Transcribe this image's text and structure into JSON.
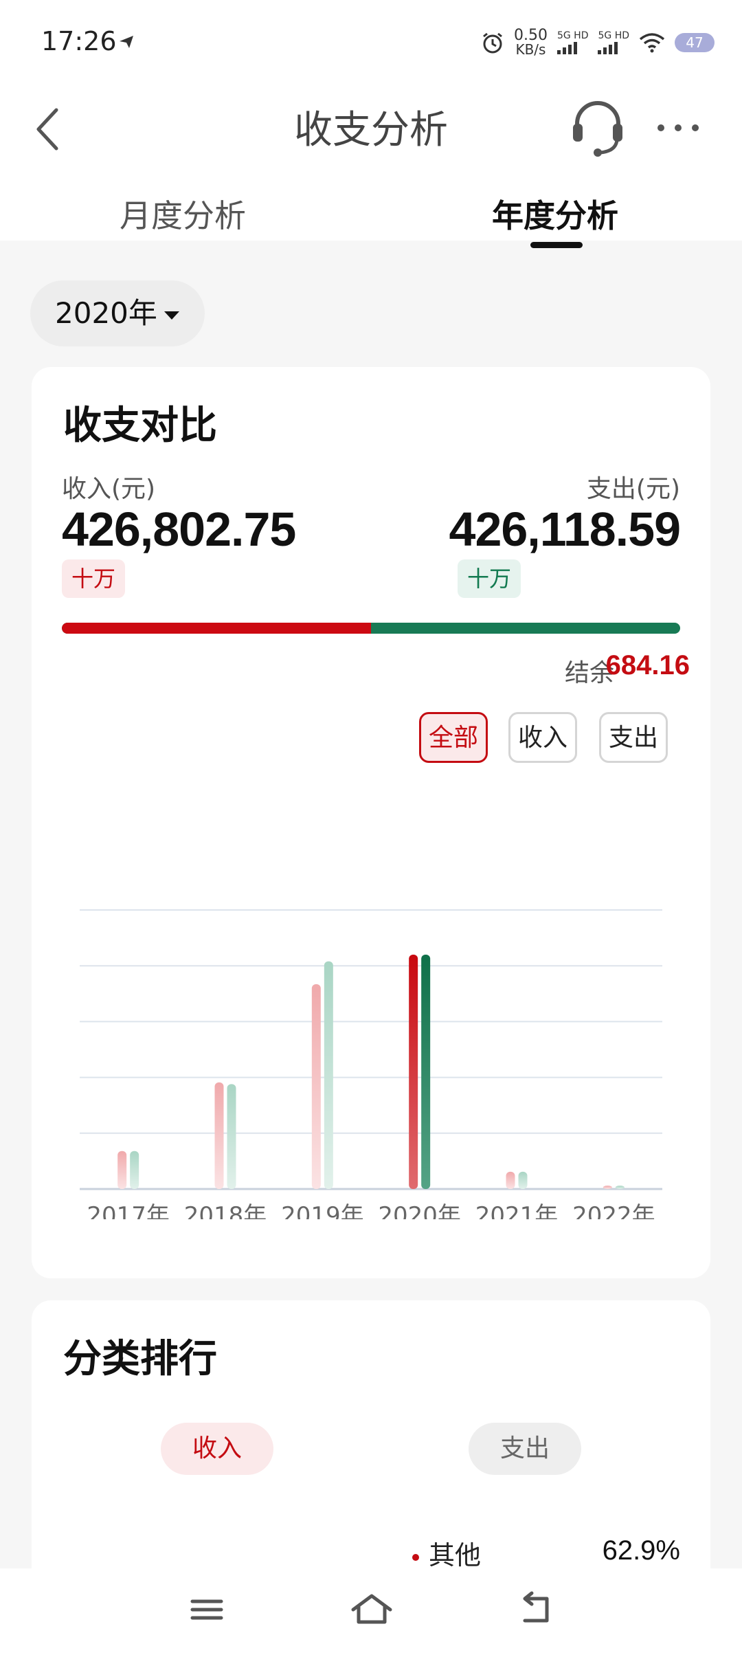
{
  "status": {
    "time": "17:26",
    "speed_value": "0.50",
    "speed_unit": "KB/s",
    "sig1_label": "5G HD",
    "sig2_label": "5G HD",
    "battery": "47"
  },
  "header": {
    "title": "收支分析",
    "tabs": [
      {
        "label": "月度分析",
        "active": false
      },
      {
        "label": "年度分析",
        "active": true
      }
    ]
  },
  "year_selector": {
    "value": "2020年"
  },
  "comparison": {
    "title": "收支对比",
    "income_label": "收入(元)",
    "income_amount": "426,802.75",
    "income_unit": "十万",
    "expense_label": "支出(元)",
    "expense_amount": "426,118.59",
    "expense_unit": "十万",
    "income_ratio": 0.5004,
    "balance_label": "结余",
    "balance_value": "684.16",
    "filters": [
      {
        "label": "全部",
        "active": true
      },
      {
        "label": "收入",
        "active": false
      },
      {
        "label": "支出",
        "active": false
      }
    ]
  },
  "chart_data": {
    "type": "bar",
    "categories": [
      "2017年",
      "2018年",
      "2019年",
      "2020年",
      "2021年",
      "2022年"
    ],
    "series": [
      {
        "values": [
          68,
          191,
          367,
          420,
          31,
          6
        ]
      },
      {
        "values": [
          68,
          188,
          408,
          420,
          31,
          6
        ]
      }
    ],
    "highlighted_category": "2020年",
    "ylim": [
      0,
      500
    ],
    "grid": true,
    "colors": {
      "income": "#cc0a12",
      "expense": "#187a55",
      "income_muted": "#f1b9bb",
      "expense_muted": "#bfddd2"
    }
  },
  "ranking": {
    "title": "分类排行",
    "tabs": [
      {
        "label": "收入",
        "active": true
      },
      {
        "label": "支出",
        "active": false
      }
    ],
    "items": [
      {
        "name": "其他",
        "percent": "62.9%"
      }
    ]
  },
  "navbar": {
    "icons": [
      "menu-icon",
      "home-icon",
      "back-icon"
    ]
  }
}
